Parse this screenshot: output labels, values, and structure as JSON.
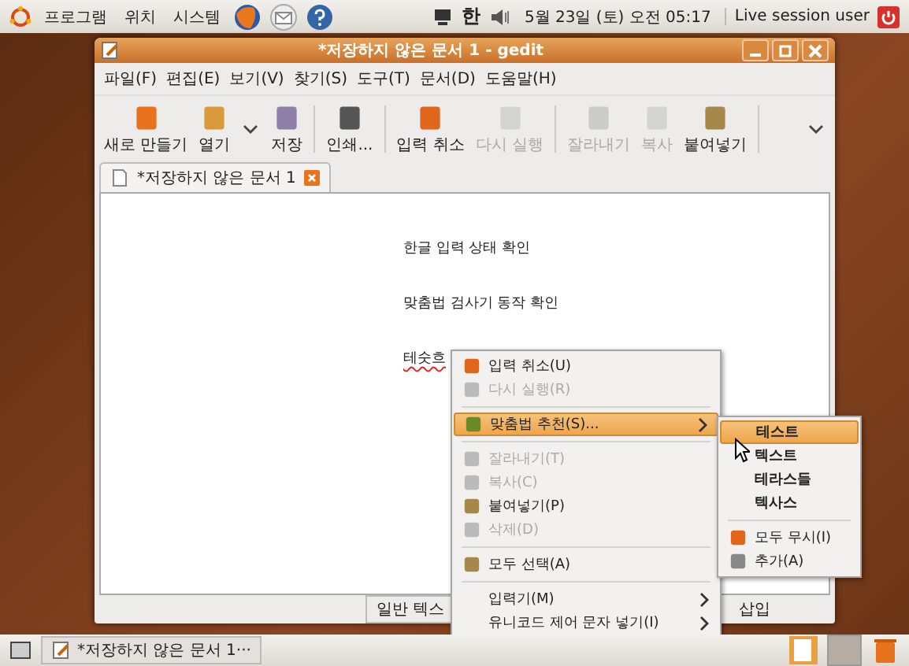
{
  "top_panel": {
    "menus": [
      "프로그램",
      "위치",
      "시스템"
    ],
    "input_method": "한",
    "clock": "5월 23일 (토) 오전 05:17",
    "user": "Live session user"
  },
  "window": {
    "title": "*저장하지 않은 문서 1 - gedit",
    "menubar": [
      "파일(F)",
      "편집(E)",
      "보기(V)",
      "찾기(S)",
      "도구(T)",
      "문서(D)",
      "도움말(H)"
    ],
    "toolbar": [
      {
        "kind": "button",
        "label": "새로 만들기",
        "disabled": false
      },
      {
        "kind": "dropdown",
        "label": "열기",
        "disabled": false
      },
      {
        "kind": "button",
        "label": "저장",
        "disabled": false
      },
      {
        "kind": "separator"
      },
      {
        "kind": "button",
        "label": "인쇄...",
        "disabled": false
      },
      {
        "kind": "separator"
      },
      {
        "kind": "button",
        "label": "입력 취소",
        "disabled": false
      },
      {
        "kind": "button",
        "label": "다시 실행",
        "disabled": true
      },
      {
        "kind": "separator"
      },
      {
        "kind": "button",
        "label": "잘라내기",
        "disabled": true
      },
      {
        "kind": "button",
        "label": "복사",
        "disabled": true
      },
      {
        "kind": "button",
        "label": "붙여넣기",
        "disabled": false
      },
      {
        "kind": "separator"
      }
    ],
    "tab": {
      "label": "*저장하지 않은 문서 1"
    },
    "document": [
      {
        "text": "한글 입력 상태 확인",
        "misspelled": false
      },
      {
        "text": "맞춤법 검사기 동작 확인",
        "misspelled": false
      },
      {
        "text": "테숫흐",
        "misspelled": true
      }
    ],
    "status_bar": {
      "language": "일반 텍스",
      "mode": "삽입"
    }
  },
  "context_menu": [
    {
      "kind": "item",
      "label": "입력 취소(U)",
      "disabled": false,
      "selected": false,
      "submenu": false
    },
    {
      "kind": "item",
      "label": "다시 실행(R)",
      "disabled": true,
      "selected": false,
      "submenu": false
    },
    {
      "kind": "separator"
    },
    {
      "kind": "item",
      "label": "맞춤법 추천(S)...",
      "disabled": false,
      "selected": true,
      "submenu": true
    },
    {
      "kind": "separator"
    },
    {
      "kind": "item",
      "label": "잘라내기(T)",
      "disabled": true,
      "selected": false,
      "submenu": false
    },
    {
      "kind": "item",
      "label": "복사(C)",
      "disabled": true,
      "selected": false,
      "submenu": false
    },
    {
      "kind": "item",
      "label": "붙여넣기(P)",
      "disabled": false,
      "selected": false,
      "submenu": false
    },
    {
      "kind": "item",
      "label": "삭제(D)",
      "disabled": true,
      "selected": false,
      "submenu": false
    },
    {
      "kind": "separator"
    },
    {
      "kind": "item",
      "label": "모두 선택(A)",
      "disabled": false,
      "selected": false,
      "submenu": false
    },
    {
      "kind": "separator"
    },
    {
      "kind": "item",
      "label": "입력기(M)",
      "disabled": false,
      "selected": false,
      "submenu": true
    },
    {
      "kind": "item",
      "label": "유니코드 제어 문자 넣기(I)",
      "disabled": false,
      "selected": false,
      "submenu": true
    }
  ],
  "suggestions_menu": [
    {
      "kind": "suggestion",
      "label": "테스트",
      "selected": true
    },
    {
      "kind": "suggestion",
      "label": "텍스트",
      "selected": false
    },
    {
      "kind": "suggestion",
      "label": "테라스들",
      "selected": false
    },
    {
      "kind": "suggestion",
      "label": "텍사스",
      "selected": false
    },
    {
      "kind": "separator"
    },
    {
      "kind": "item",
      "label": "모두 무시(I)",
      "selected": false
    },
    {
      "kind": "item",
      "label": "추가(A)",
      "selected": false
    }
  ],
  "taskbar": {
    "task": "*저장하지 않은 문서 1···"
  }
}
